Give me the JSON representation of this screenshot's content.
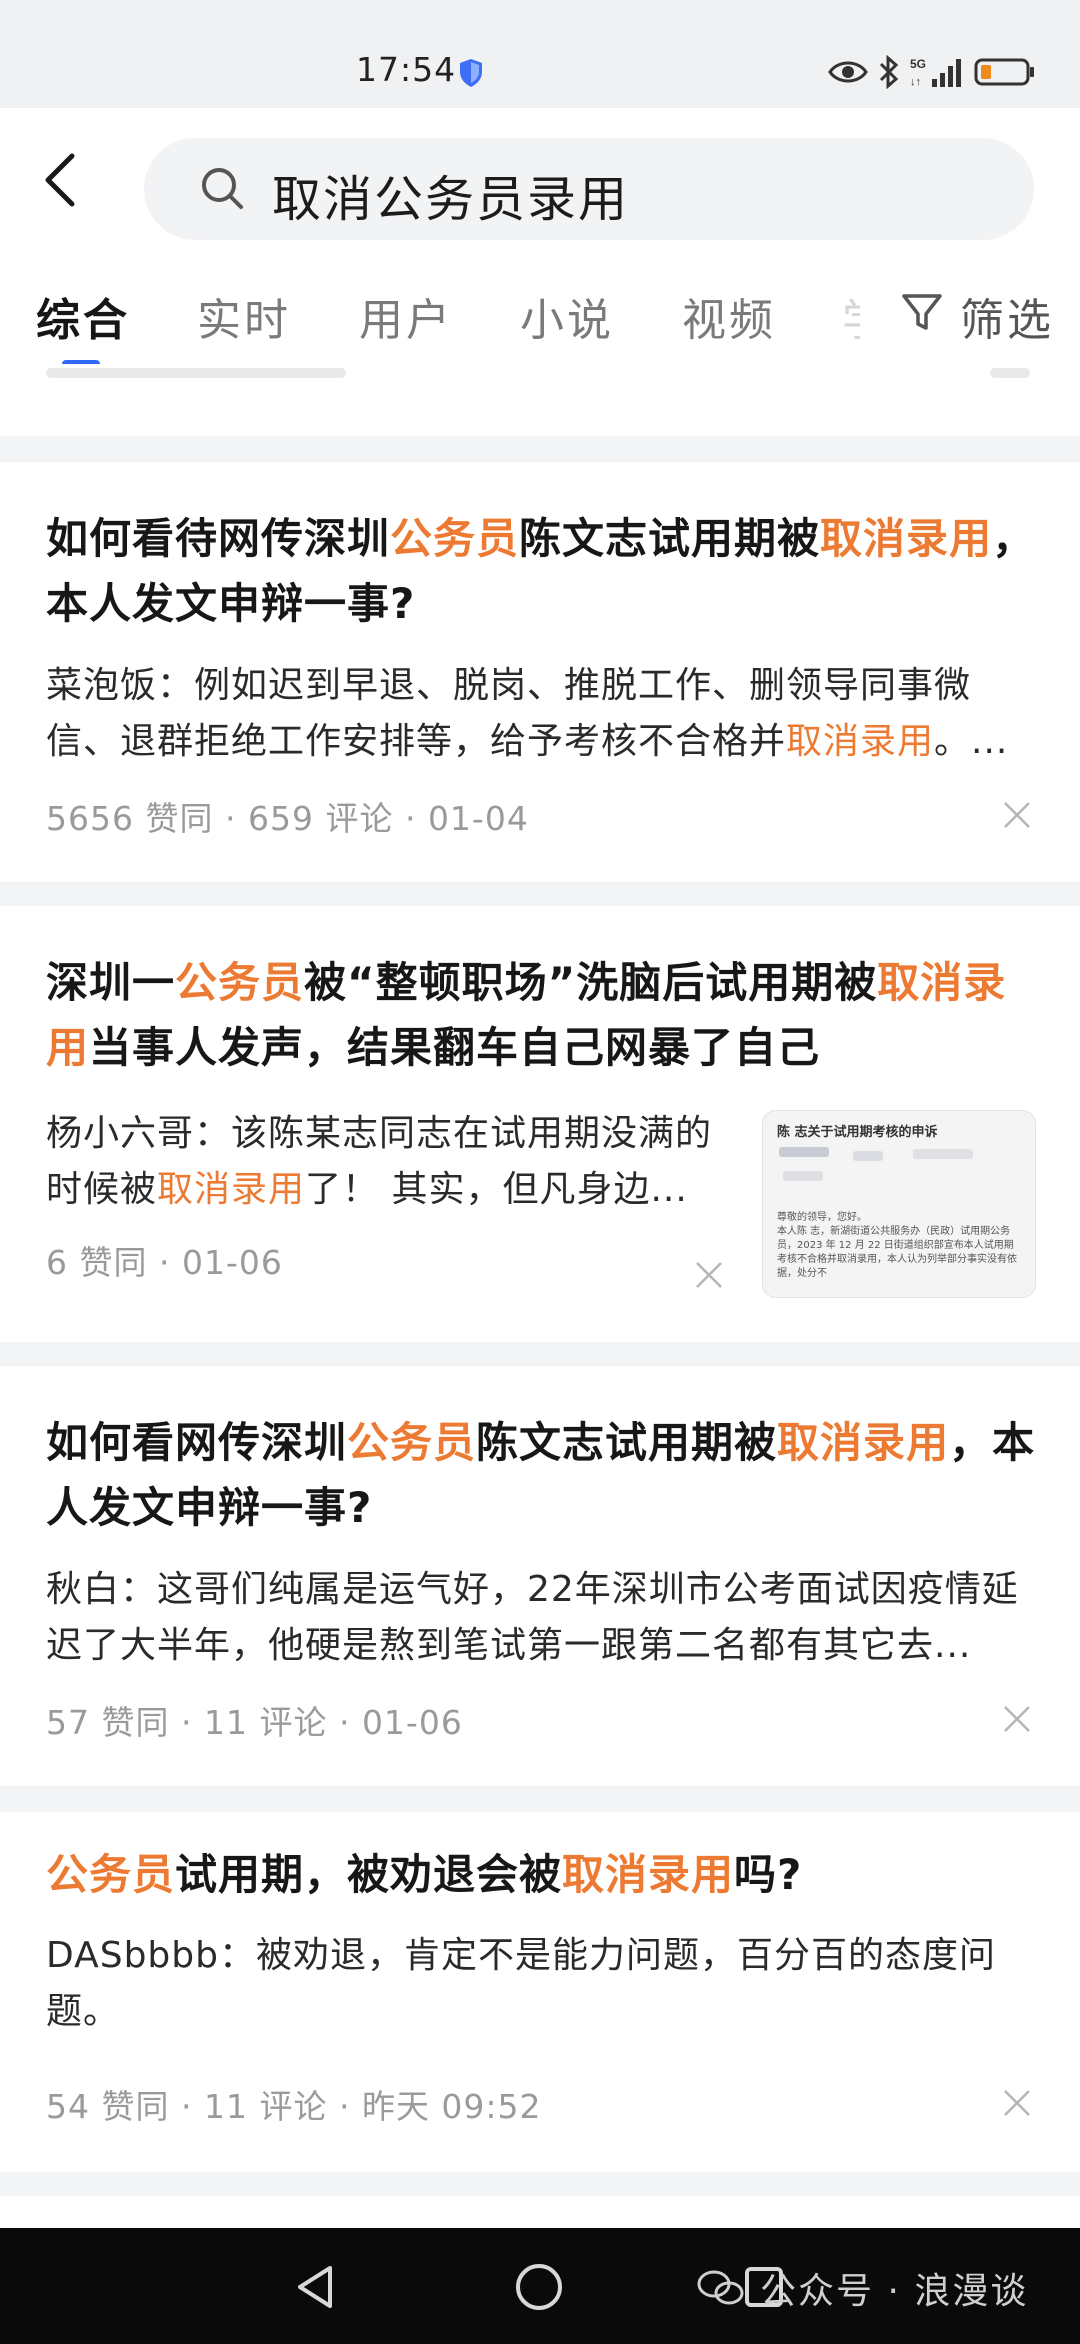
{
  "status_bar": {
    "time": "17:54"
  },
  "search": {
    "query": "取消公务员录用"
  },
  "tabs": [
    {
      "label": "综合"
    },
    {
      "label": "实时"
    },
    {
      "label": "用户"
    },
    {
      "label": "小说"
    },
    {
      "label": "视频"
    },
    {
      "label": "学"
    }
  ],
  "filter_label": "筛选",
  "results": [
    {
      "title_parts": [
        "如何看待网传深圳",
        "公务员",
        "陈文志试用期被",
        "取消录",
        "用",
        "，本人发文申辩一事?"
      ],
      "body_parts": [
        "菜泡饭：例如迟到早退、脱岗、推脱工作、删领导同事微信、退群拒绝工作安排等，给予考核不合格并",
        "取消录用",
        "。..."
      ],
      "likes": "5656 赞同",
      "comments": "659 评论",
      "date": "01-04"
    },
    {
      "title_parts": [
        "深圳一",
        "公务员",
        "被“整顿职场”洗脑后试用期被",
        "取消",
        "录用",
        "当事人发声，结果翻车自己网暴了自己"
      ],
      "body_parts": [
        "杨小六哥：该陈某志同志在试用期没满的时候被",
        "取消录用",
        "了！ 其实，但凡身边..."
      ],
      "likes": "6 赞同",
      "date": "01-06",
      "thumbnail": {
        "title": "陈 志关于试用期考核的申诉",
        "lines": [
          "尊敬的领导，您好。",
          "本人陈 志，新湖街道公共服务办（民政）试用期公务员，2023 年 12 月 22 日街道组织部宣布本人试用期考核不合格并取消录用，本人认为列举部分事实没有依据，处分不"
        ]
      }
    },
    {
      "title_parts": [
        "如何看网传深圳",
        "公务员",
        "陈文志试用期被",
        "取消录",
        "用",
        "，本人发文申辩一事?"
      ],
      "body_parts": [
        "秋白：这哥们纯属是运气好，22年深圳市公考面试因疫情延迟了大半年，他硬是熬到笔试第一跟第二名都有其它去..."
      ],
      "likes": "57 赞同",
      "comments": "11 评论",
      "date": "01-06"
    },
    {
      "title_parts": [
        "公务员",
        "试用期，被劝退会被",
        "取消录用",
        "吗?"
      ],
      "body_parts": [
        "DASbbbb：被劝退，肯定不是能力问题，百分百的态度问题。"
      ],
      "likes": "54 赞同",
      "comments": "11 评论",
      "date": "昨天 09:52"
    }
  ],
  "meta_separator": " · ",
  "watermark": "公众号 · 浪漫谈",
  "colors": {
    "highlight": "#ec7a33",
    "tab_indicator": "#2f67f6",
    "background": "#f3f4f6"
  }
}
